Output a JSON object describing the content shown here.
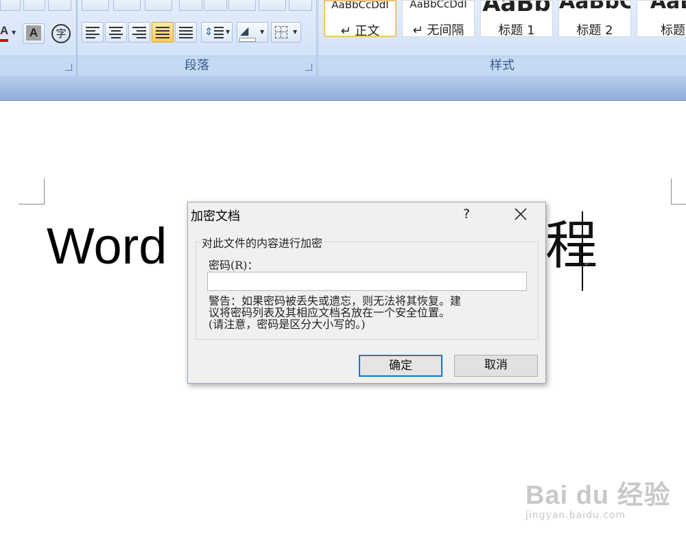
{
  "ribbon": {
    "paragraph_group_label": "段落",
    "styles_group_label": "样式",
    "font_buttons": {
      "font_color_letter": "A",
      "char_shading_letter": "A",
      "enclose_char": "字"
    },
    "styles": [
      {
        "sample": "AaBbCcDdI",
        "name": "↵ 正文",
        "selected": true
      },
      {
        "sample": "AaBbCcDdI",
        "name": "↵ 无间隔",
        "selected": false
      },
      {
        "sample": "AaBb",
        "name": "标题 1",
        "selected": false
      },
      {
        "sample": "AaBbC",
        "name": "标题 2",
        "selected": false
      },
      {
        "sample": "AaB",
        "name": "标题",
        "selected": false
      }
    ]
  },
  "document": {
    "text_left": "Word",
    "text_right": "程",
    "paragraph_mark": "↵"
  },
  "dialog": {
    "title": "加密文档",
    "help": "?",
    "group_legend": "对此文件的内容进行加密",
    "password_label": "密码(R)：",
    "password_value": "",
    "warning_text": "警告：如果密码被丢失或遗忘，则无法将其恢复。建\n议将密码列表及其相应文档名放在一个安全位置。\n(请注意，密码是区分大小写的。)",
    "ok_label": "确定",
    "cancel_label": "取消"
  },
  "watermark": {
    "logo": "Bai du 经验",
    "url": "jingyan.baidu.com"
  },
  "colors": {
    "ribbon_bg": "#d3e3f7",
    "ok_border": "#0078d7",
    "font_color_bar": "#e00000",
    "active_button": "#ffc95a"
  }
}
